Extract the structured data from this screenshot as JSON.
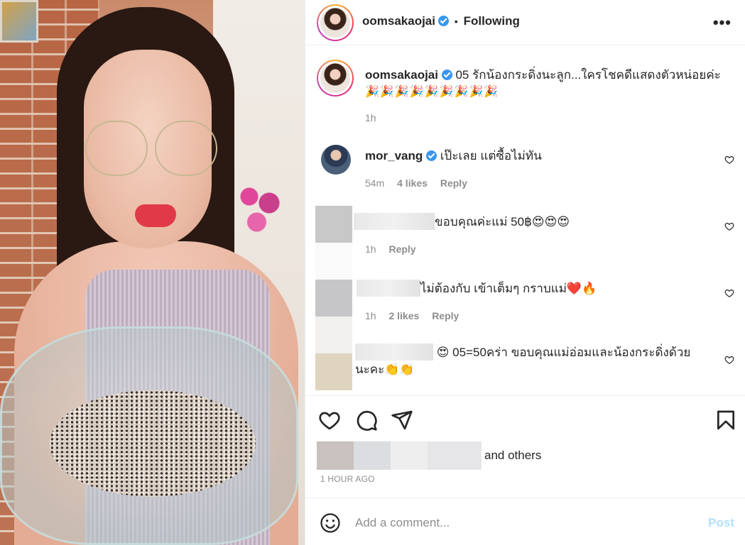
{
  "header": {
    "username": "oomsakaojai",
    "separator": "•",
    "follow_state": "Following",
    "more_label": "•••"
  },
  "caption": {
    "username": "oomsakaojai",
    "text": "05 รักน้องกระดิ่งนะลูก...ใครโชคดีแสดงตัวหน่อยค่ะ",
    "emoji": "🎉🎉🎉🎉🎉🎉🎉🎉🎉",
    "time": "1h"
  },
  "comments": [
    {
      "username": "mor_vang",
      "verified": true,
      "text": "เป๊ะเลย แต่ซื้อไม่ทัน",
      "time": "54m",
      "likes": "4 likes",
      "reply": "Reply"
    },
    {
      "username": "",
      "text": "ขอบคุณค่ะแม่ 50฿😍😍😍",
      "time": "1h",
      "likes": "",
      "reply": "Reply"
    },
    {
      "username": "",
      "text": "ไม่ต้องกับ เข้าเต็มๆ กราบแม่❤️🔥",
      "time": "1h",
      "likes": "2 likes",
      "reply": "Reply"
    },
    {
      "username": "",
      "text": "😍 05=50คร่า ขอบคุณแม่อ่อมและน้องกระดิ่งด้วยนะคะ👏👏",
      "time": "",
      "likes": "",
      "reply": ""
    }
  ],
  "likes": {
    "others_text": "and others"
  },
  "timestamp": "1 HOUR AGO",
  "composer": {
    "placeholder": "Add a comment...",
    "post_label": "Post"
  },
  "colors": {
    "accent": "#3897f0",
    "muted": "#8e8e8e",
    "post_disabled": "#b2dffc"
  },
  "icons": [
    "more-icon",
    "verified-icon",
    "heart-icon",
    "comment-icon",
    "share-icon",
    "bookmark-icon",
    "emoji-icon"
  ]
}
